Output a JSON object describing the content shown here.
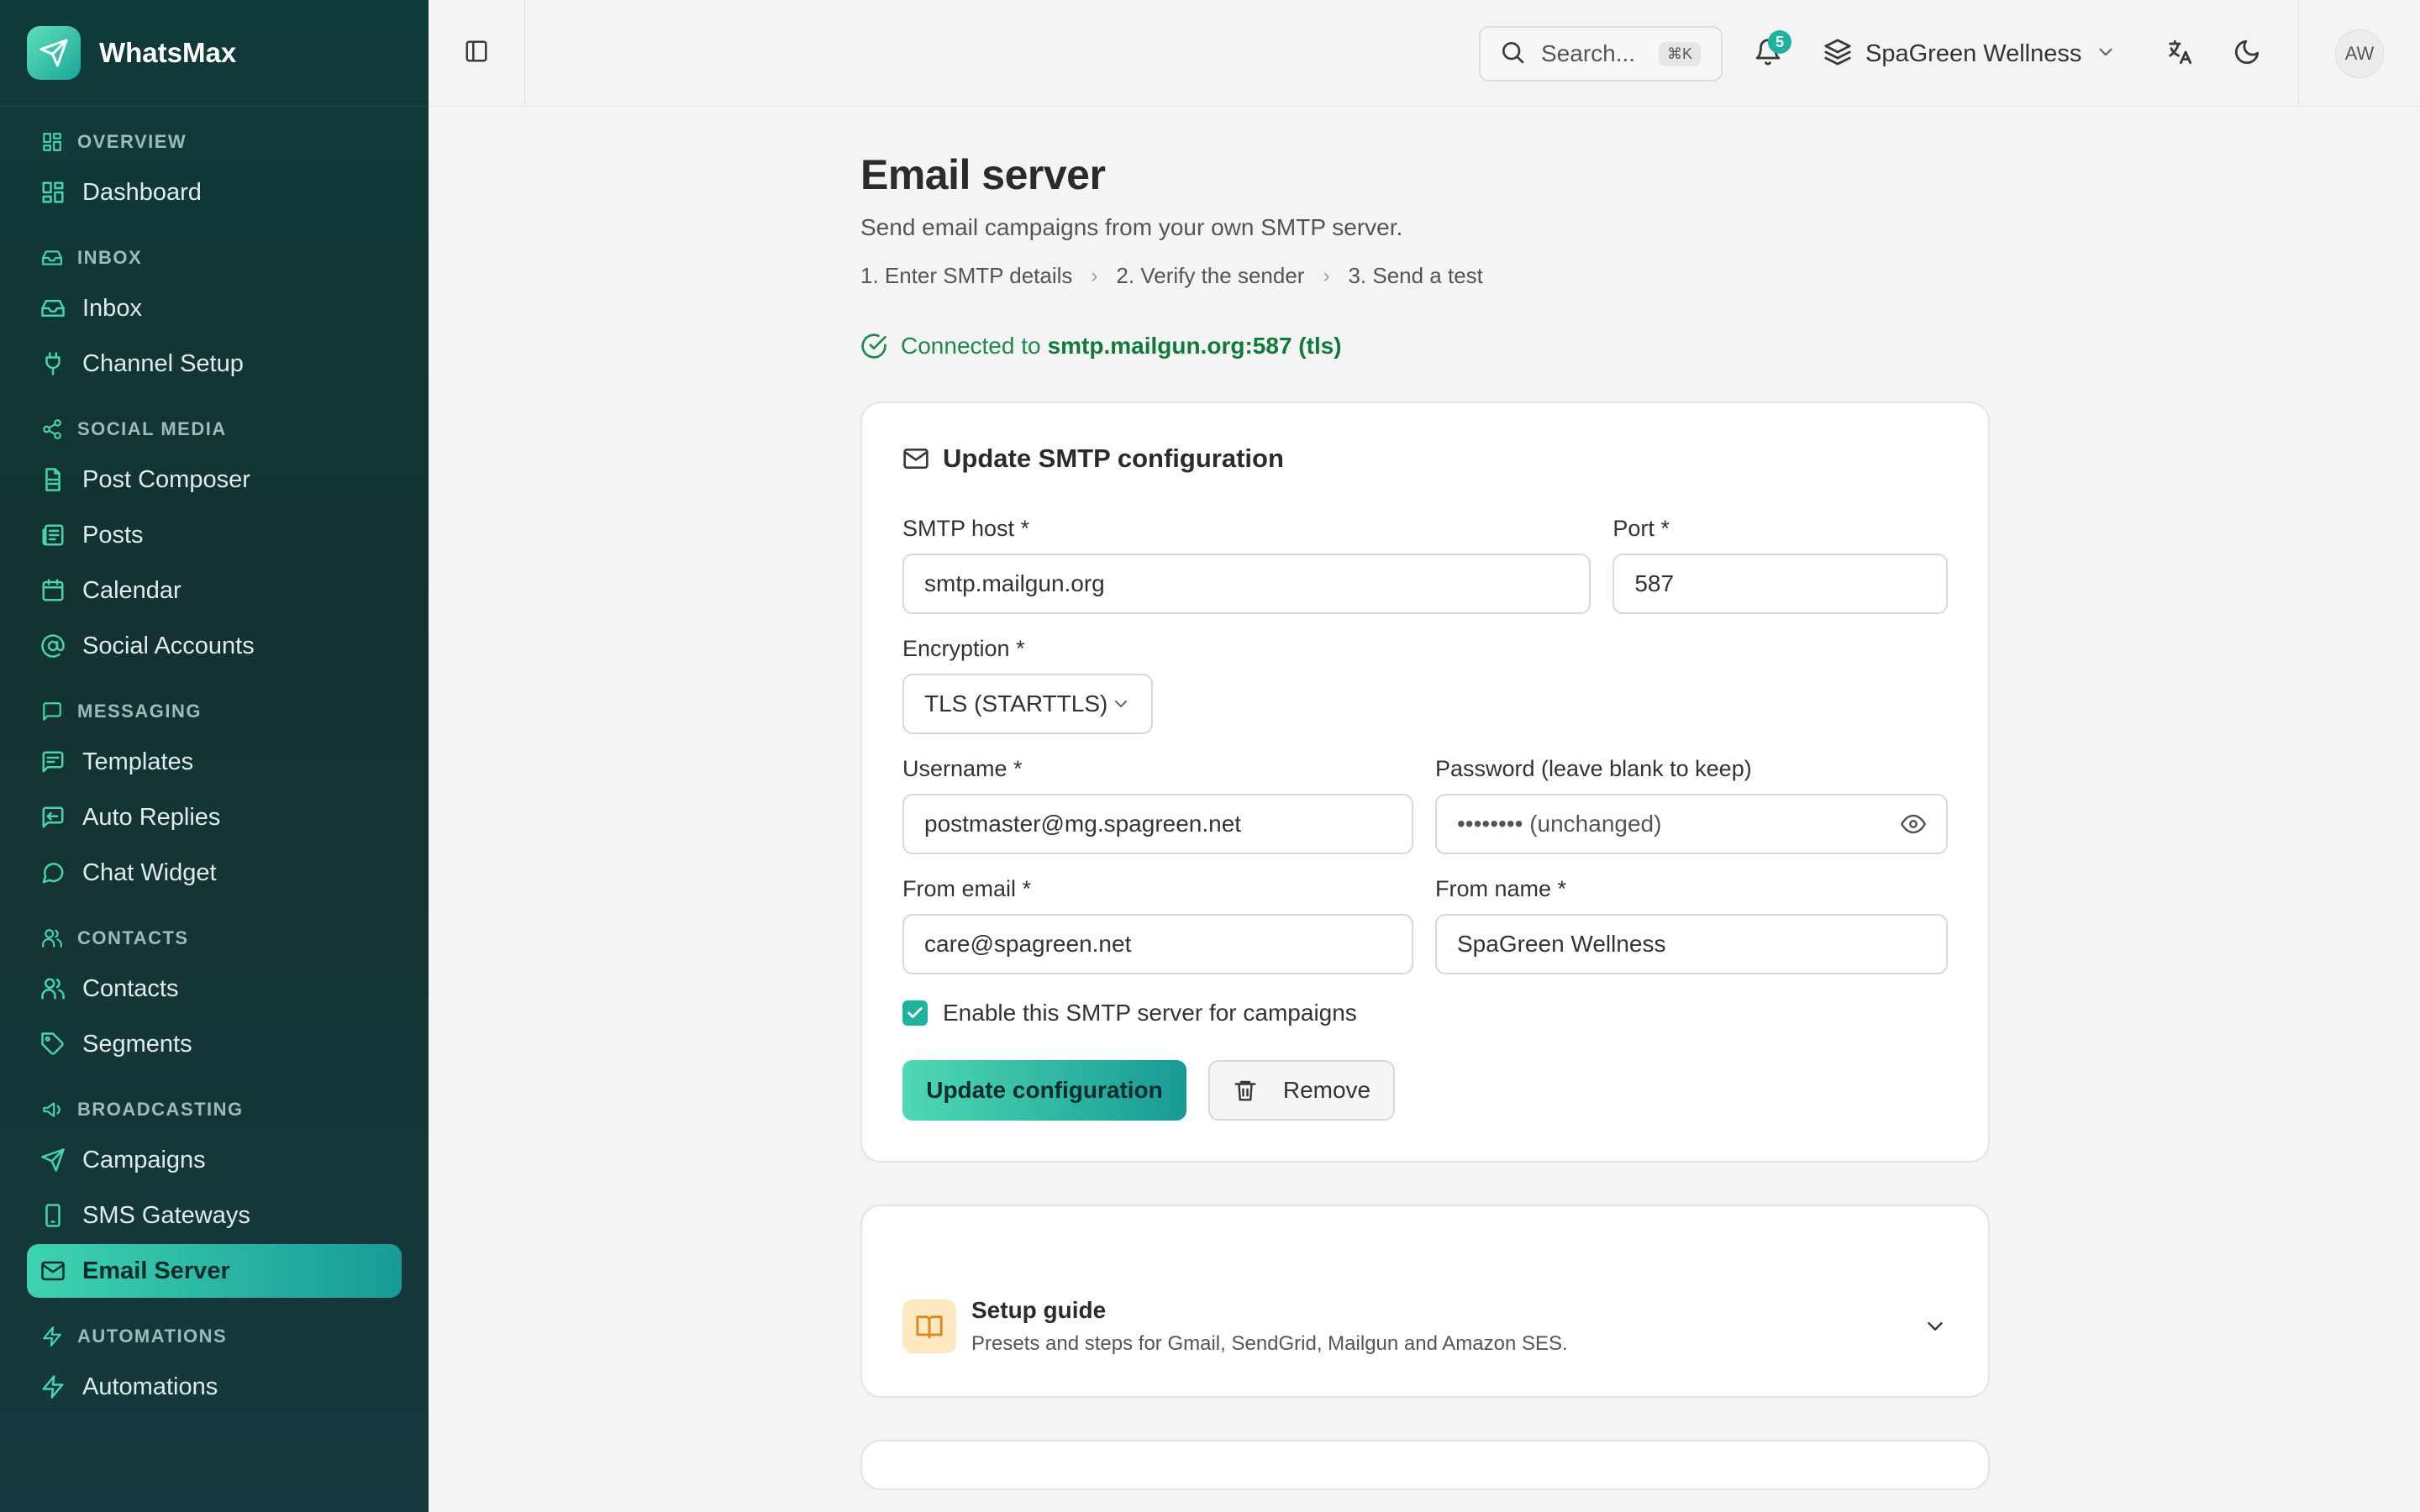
{
  "app": {
    "name": "WhatsMax"
  },
  "sidebar": {
    "sections": [
      {
        "label": "OVERVIEW",
        "items": [
          {
            "label": "Dashboard"
          }
        ]
      },
      {
        "label": "INBOX",
        "items": [
          {
            "label": "Inbox"
          },
          {
            "label": "Channel Setup"
          }
        ]
      },
      {
        "label": "SOCIAL MEDIA",
        "items": [
          {
            "label": "Post Composer"
          },
          {
            "label": "Posts"
          },
          {
            "label": "Calendar"
          },
          {
            "label": "Social Accounts"
          }
        ]
      },
      {
        "label": "MESSAGING",
        "items": [
          {
            "label": "Templates"
          },
          {
            "label": "Auto Replies"
          },
          {
            "label": "Chat Widget"
          }
        ]
      },
      {
        "label": "CONTACTS",
        "items": [
          {
            "label": "Contacts"
          },
          {
            "label": "Segments"
          }
        ]
      },
      {
        "label": "BROADCASTING",
        "items": [
          {
            "label": "Campaigns"
          },
          {
            "label": "SMS Gateways"
          },
          {
            "label": "Email Server"
          }
        ]
      },
      {
        "label": "AUTOMATIONS",
        "items": [
          {
            "label": "Automations"
          }
        ]
      }
    ],
    "active_item": "Email Server"
  },
  "topbar": {
    "search_placeholder": "Search...",
    "search_shortcut": "⌘K",
    "notification_count": "5",
    "workspace_name": "SpaGreen Wellness",
    "avatar_initials": "AW"
  },
  "page": {
    "title": "Email server",
    "subtitle": "Send email campaigns from your own SMTP server.",
    "steps": [
      "1.  Enter SMTP details",
      "2.  Verify the sender",
      "3.  Send a test"
    ],
    "status_prefix": "Connected to",
    "status_host": "smtp.mailgun.org:587 (tls)"
  },
  "form": {
    "title": "Update SMTP configuration",
    "smtp_host_label": "SMTP host *",
    "smtp_host_value": "smtp.mailgun.org",
    "port_label": "Port *",
    "port_value": "587",
    "encryption_label": "Encryption *",
    "encryption_value": "TLS (STARTTLS)",
    "username_label": "Username *",
    "username_value": "postmaster@mg.spagreen.net",
    "password_label": "Password (leave blank to keep)",
    "password_placeholder": "•••••••• (unchanged)",
    "from_email_label": "From email *",
    "from_email_value": "care@spagreen.net",
    "from_name_label": "From name *",
    "from_name_value": "SpaGreen Wellness",
    "enable_label": "Enable this SMTP server for campaigns",
    "enable_checked": true,
    "update_button": "Update configuration",
    "remove_button": "Remove"
  },
  "guide": {
    "title": "Setup guide",
    "description": "Presets and steps for Gmail, SendGrid, Mailgun and Amazon SES."
  },
  "colors": {
    "accent": "#1fb39e",
    "success": "#1a8a4a",
    "sidebar_bg": "#13322f"
  }
}
